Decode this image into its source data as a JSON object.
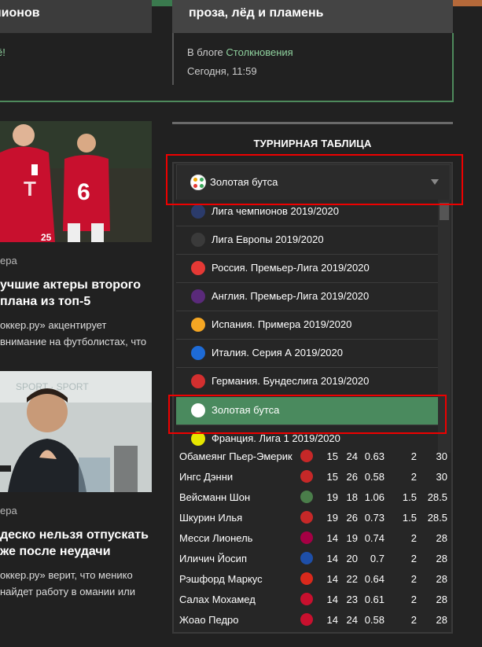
{
  "top_cards": {
    "left_title": "пионов",
    "right_title": "проза, лёд и пламень"
  },
  "blog": {
    "left_text": "ё!",
    "in_label": "В блоге",
    "link": "Столкновения",
    "date": "Сегодня, 11:59"
  },
  "articles": [
    {
      "category": "ера",
      "title": "учшие актеры второго плана из топ-5",
      "desc": "оккер.ру» акцентирует внимание на футболистах, что"
    },
    {
      "category": "ера",
      "title": "деско нельзя отпускать же после неудачи",
      "desc": "оккер.ру» верит, что менико найдет работу в омании или"
    }
  ],
  "photo1": {
    "jersey_numbers": [
      "25",
      "6"
    ]
  },
  "standings": {
    "title": "ТУРНИРНАЯ ТАБЛИЦА",
    "selected": "Золотая бутса",
    "dropdown_items": [
      {
        "label": "Лига чемпионов 2019/2020",
        "icon": "ucl-icon",
        "color": "#2b3b6b"
      },
      {
        "label": "Лига Европы 2019/2020",
        "icon": "uel-icon",
        "color": "#3a3a3a"
      },
      {
        "label": "Россия. Премьер-Лига 2019/2020",
        "icon": "rpl-icon",
        "color": "#e53935"
      },
      {
        "label": "Англия. Премьер-Лига 2019/2020",
        "icon": "epl-icon",
        "color": "#5a2a7a"
      },
      {
        "label": "Испания. Примера 2019/2020",
        "icon": "laliga-icon",
        "color": "#f5a623"
      },
      {
        "label": "Италия. Серия А 2019/2020",
        "icon": "seriea-icon",
        "color": "#1e6bd6"
      },
      {
        "label": "Германия. Бундеслига 2019/2020",
        "icon": "bundesliga-icon",
        "color": "#d32f2f"
      },
      {
        "label": "Золотая бутса",
        "icon": "golden-boot-icon",
        "color": "#ffffff"
      },
      {
        "label": "Франция. Лига 1 2019/2020",
        "icon": "ligue1-icon",
        "color": "#e6e600"
      }
    ],
    "selected_index": 7,
    "rows": [
      {
        "name": "Обамеянг Пьер-Эмерик",
        "crest": "#c62828",
        "c1": "15",
        "c2": "24",
        "c3": "0.63",
        "c4": "2",
        "c5": "30"
      },
      {
        "name": "Ингс Дэнни",
        "crest": "#c62828",
        "c1": "15",
        "c2": "26",
        "c3": "0.58",
        "c4": "2",
        "c5": "30"
      },
      {
        "name": "Вейсманн Шон",
        "crest": "#4a7d4a",
        "c1": "19",
        "c2": "18",
        "c3": "1.06",
        "c4": "1.5",
        "c5": "28.5"
      },
      {
        "name": "Шкурин Илья",
        "crest": "#c62828",
        "c1": "19",
        "c2": "26",
        "c3": "0.73",
        "c4": "1.5",
        "c5": "28.5"
      },
      {
        "name": "Месси Лионель",
        "crest": "#a50044",
        "c1": "14",
        "c2": "19",
        "c3": "0.74",
        "c4": "2",
        "c5": "28"
      },
      {
        "name": "Иличич Йосип",
        "crest": "#1e4fa8",
        "c1": "14",
        "c2": "20",
        "c3": "0.7",
        "c4": "2",
        "c5": "28"
      },
      {
        "name": "Рэшфорд Маркус",
        "crest": "#da291c",
        "c1": "14",
        "c2": "22",
        "c3": "0.64",
        "c4": "2",
        "c5": "28"
      },
      {
        "name": "Салах Мохамед",
        "crest": "#c8102e",
        "c1": "14",
        "c2": "23",
        "c3": "0.61",
        "c4": "2",
        "c5": "28"
      },
      {
        "name": "Жоао Педро",
        "crest": "#c8102e",
        "c1": "14",
        "c2": "24",
        "c3": "0.58",
        "c4": "2",
        "c5": "28"
      }
    ]
  }
}
